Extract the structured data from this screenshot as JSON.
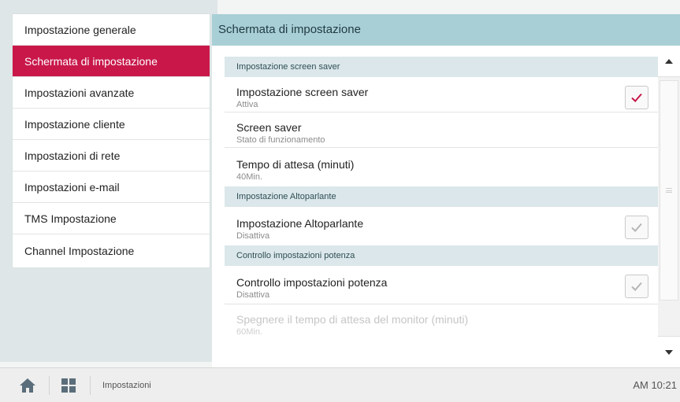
{
  "sidebar": {
    "items": [
      {
        "label": "Impostazione generale"
      },
      {
        "label": "Schermata di impostazione"
      },
      {
        "label": "Impostazioni avanzate"
      },
      {
        "label": "Impostazione cliente"
      },
      {
        "label": "Impostazioni di rete"
      },
      {
        "label": "Impostazioni e-mail"
      },
      {
        "label": "TMS Impostazione"
      },
      {
        "label": "Channel Impostazione"
      }
    ],
    "active_index": 1
  },
  "panel": {
    "title": "Schermata di impostazione"
  },
  "sections": [
    {
      "header": "Impostazione screen saver",
      "items": [
        {
          "title": "Impostazione screen saver",
          "sub": "Attiva",
          "checked": true
        },
        {
          "title": "Screen saver",
          "sub": "Stato di funzionamento"
        },
        {
          "title": "Tempo di attesa (minuti)",
          "sub": "40Min."
        }
      ]
    },
    {
      "header": "Impostazione Altoparlante",
      "items": [
        {
          "title": "Impostazione Altoparlante",
          "sub": "Disattiva",
          "checked": false
        }
      ]
    },
    {
      "header": "Controllo impostazioni potenza",
      "items": [
        {
          "title": "Controllo impostazioni potenza",
          "sub": "Disattiva",
          "checked": false
        },
        {
          "title": "Spegnere il tempo di attesa del monitor (minuti)",
          "sub": "60Min.",
          "disabled": true
        }
      ]
    }
  ],
  "colors": {
    "accent": "#c9174a",
    "header_bg": "#a9cfd6",
    "section_bg": "#dbe7ea",
    "check_on": "#c9174a",
    "check_off": "#b5b5b5"
  },
  "bottom_bar": {
    "home_icon": "home-icon",
    "apps_icon": "apps-grid-icon",
    "breadcrumb": "Impostazioni",
    "clock": "AM 10:21"
  }
}
